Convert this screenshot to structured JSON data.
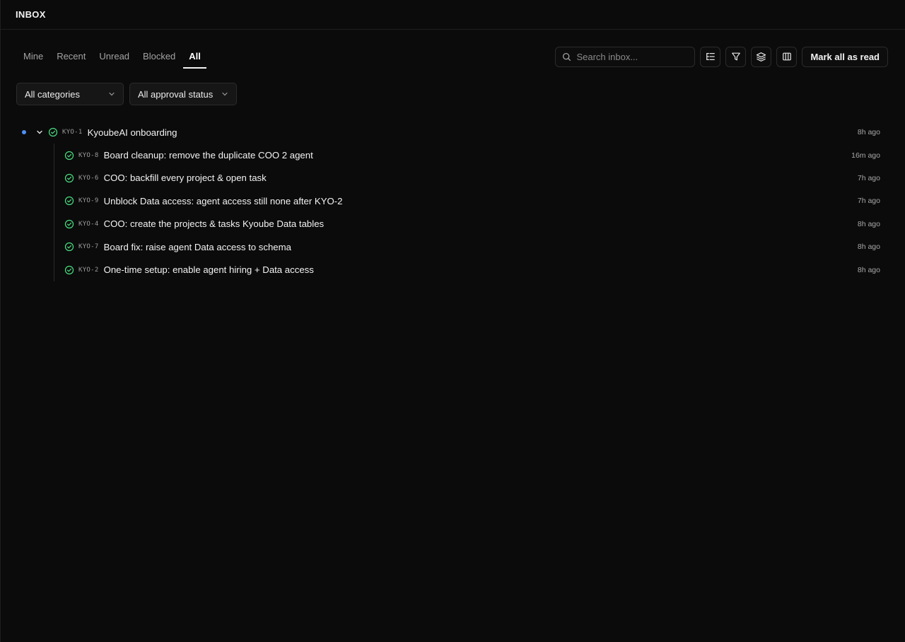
{
  "header": {
    "title": "INBOX"
  },
  "tabs": [
    {
      "label": "Mine",
      "active": false
    },
    {
      "label": "Recent",
      "active": false
    },
    {
      "label": "Unread",
      "active": false
    },
    {
      "label": "Blocked",
      "active": false
    },
    {
      "label": "All",
      "active": true
    }
  ],
  "search": {
    "placeholder": "Search inbox...",
    "value": ""
  },
  "toolbar": {
    "list_view_icon": "list-tree-icon",
    "filter_icon": "filter-icon",
    "layers_icon": "layers-icon",
    "columns_icon": "columns-icon",
    "mark_all_label": "Mark all as read"
  },
  "filters": {
    "category": "All categories",
    "approval": "All approval status"
  },
  "colors": {
    "background": "#0b0b0b",
    "unread_dot": "#4f8ff7",
    "status_done": "#4ade80"
  },
  "parent": {
    "id": "KYO-1",
    "title": "KyoubeAI onboarding",
    "time": "8h ago",
    "unread": true,
    "status": "done"
  },
  "children": [
    {
      "id": "KYO-8",
      "title": "Board cleanup: remove the duplicate COO 2 agent",
      "time": "16m ago",
      "status": "done"
    },
    {
      "id": "KYO-6",
      "title": "COO: backfill every project & open task",
      "time": "7h ago",
      "status": "done"
    },
    {
      "id": "KYO-9",
      "title": "Unblock Data access: agent access still none after KYO-2",
      "time": "7h ago",
      "status": "done"
    },
    {
      "id": "KYO-4",
      "title": "COO: create the projects & tasks Kyoube Data tables",
      "time": "8h ago",
      "status": "done"
    },
    {
      "id": "KYO-7",
      "title": "Board fix: raise agent Data access to schema",
      "time": "8h ago",
      "status": "done"
    },
    {
      "id": "KYO-2",
      "title": "One-time setup: enable agent hiring + Data access",
      "time": "8h ago",
      "status": "done"
    }
  ]
}
